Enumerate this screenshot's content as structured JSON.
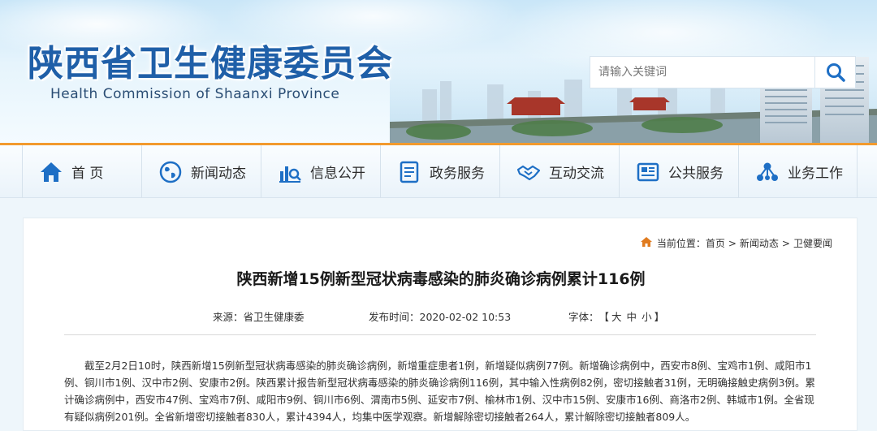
{
  "header": {
    "title": "陕西省卫生健康委员会",
    "subtitle": "Health Commission of Shaanxi Province",
    "search_placeholder": "请输入关键词"
  },
  "nav": {
    "items": [
      {
        "label": "首 页",
        "icon": "home-icon"
      },
      {
        "label": "新闻动态",
        "icon": "globe-icon"
      },
      {
        "label": "信息公开",
        "icon": "chart-search-icon"
      },
      {
        "label": "政务服务",
        "icon": "document-icon"
      },
      {
        "label": "互动交流",
        "icon": "handshake-icon"
      },
      {
        "label": "公共服务",
        "icon": "newspaper-icon"
      },
      {
        "label": "业务工作",
        "icon": "network-icon"
      }
    ]
  },
  "breadcrumb": {
    "prefix": "当前位置：",
    "items": [
      "首页",
      "新闻动态",
      "卫健要闻"
    ],
    "separator": ">"
  },
  "article": {
    "title": "陕西新增15例新型冠状病毒感染的肺炎确诊病例累计116例",
    "source": "来源：省卫生健康委",
    "publish_time": "发布时间：2020-02-02 10:53",
    "font_label": "字体：",
    "font_open": "【",
    "font_sizes": [
      "大",
      "中",
      "小"
    ],
    "font_close": "】",
    "body": "截至2月2日10时，陕西新增15例新型冠状病毒感染的肺炎确诊病例，新增重症患者1例，新增疑似病例77例。新增确诊病例中，西安市8例、宝鸡市1例、咸阳市1例、铜川市1例、汉中市2例、安康市2例。陕西累计报告新型冠状病毒感染的肺炎确诊病例116例，其中输入性病例82例，密切接触者31例，无明确接触史病例3例。累计确诊病例中，西安市47例、宝鸡市7例、咸阳市9例、铜川市6例、渭南市5例、延安市7例、榆林市1例、汉中市15例、安康市16例、商洛市2例、韩城市1例。全省现有疑似病例201例。全省新增密切接触者830人，累计4394人，均集中医学观察。新增解除密切接触者264人，累计解除密切接触者809人。"
  },
  "colors": {
    "brand_blue": "#1f5fa8",
    "nav_accent": "#f29a2e",
    "icon_blue": "#1e6fc5",
    "breadcrumb_icon": "#e07b1f"
  }
}
